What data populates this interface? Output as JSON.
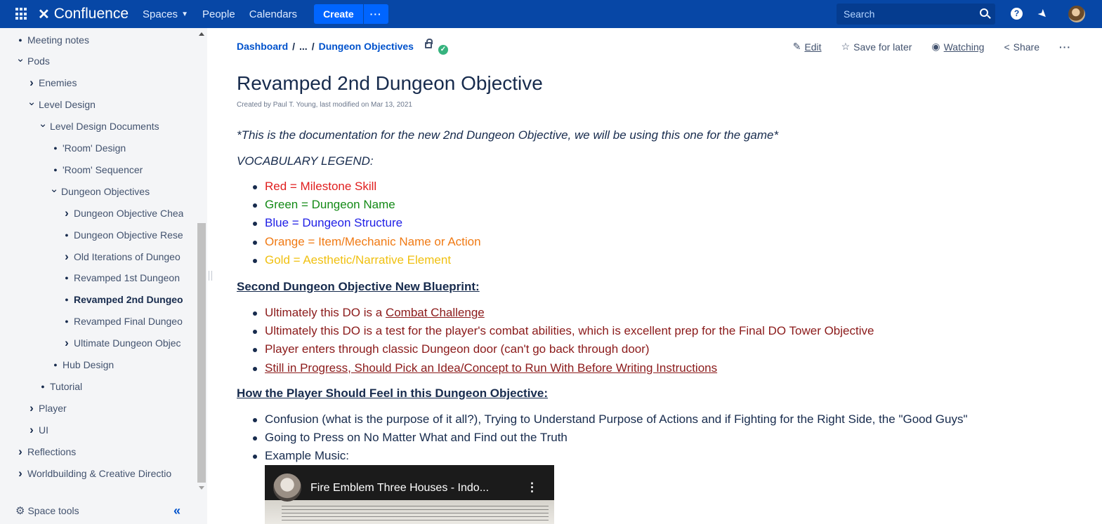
{
  "topnav": {
    "logo_text": "Confluence",
    "spaces_label": "Spaces",
    "people_label": "People",
    "calendars_label": "Calendars",
    "create_label": "Create",
    "more_label": "···",
    "search_placeholder": "Search",
    "help_label": "?",
    "brand_color": "#0747a6",
    "accent_color": "#0065ff"
  },
  "sidebar": {
    "items": [
      {
        "label": "Meeting notes",
        "marker": "bullet"
      },
      {
        "label": "Pods",
        "marker": "expanded"
      },
      {
        "label": "Enemies",
        "marker": "collapsed"
      },
      {
        "label": "Level Design",
        "marker": "expanded"
      },
      {
        "label": "Level Design Documents",
        "marker": "expanded"
      },
      {
        "label": "'Room' Design",
        "marker": "bullet"
      },
      {
        "label": "'Room' Sequencer",
        "marker": "bullet"
      },
      {
        "label": "Dungeon Objectives",
        "marker": "expanded"
      },
      {
        "label": "Dungeon Objective Chea",
        "marker": "collapsed"
      },
      {
        "label": "Dungeon Objective Rese",
        "marker": "bullet"
      },
      {
        "label": "Old Iterations of Dungeo",
        "marker": "collapsed"
      },
      {
        "label": "Revamped 1st Dungeon",
        "marker": "bullet"
      },
      {
        "label": "Revamped 2nd Dungeo",
        "marker": "bullet",
        "active": true
      },
      {
        "label": "Revamped Final Dungeo",
        "marker": "bullet"
      },
      {
        "label": "Ultimate Dungeon Objec",
        "marker": "collapsed"
      },
      {
        "label": "Hub Design",
        "marker": "bullet"
      },
      {
        "label": "Tutorial",
        "marker": "bullet"
      },
      {
        "label": "Player",
        "marker": "collapsed"
      },
      {
        "label": "UI",
        "marker": "collapsed"
      },
      {
        "label": "Reflections",
        "marker": "collapsed"
      },
      {
        "label": "Worldbuilding & Creative Directio",
        "marker": "collapsed"
      }
    ],
    "space_tools_label": "Space tools"
  },
  "breadcrumbs": {
    "root": "Dashboard",
    "ellipsis": "...",
    "parent": "Dungeon Objectives"
  },
  "page_actions": {
    "edit": "Edit",
    "save_for_later": "Save for later",
    "watching": "Watching",
    "share": "Share",
    "more": "···"
  },
  "page": {
    "title": "Revamped 2nd Dungeon Objective",
    "byline": "Created by Paul T. Young, last modified on Mar 13, 2021",
    "intro": "*This is the documentation for the new 2nd Dungeon Objective, we will be using this one for the game*",
    "vocab_heading": "VOCABULARY LEGEND:",
    "legend": [
      {
        "text": "Red = Milestone Skill",
        "color": "#e01e1e"
      },
      {
        "text": "Green = Dungeon Name",
        "color": "#138a16"
      },
      {
        "text": "Blue = Dungeon Structure",
        "color": "#2020e6"
      },
      {
        "text": "Orange = Item/Mechanic Name or Action",
        "color": "#f07a14"
      },
      {
        "text": "Gold = Aesthetic/Narrative Element",
        "color": "#f0c010"
      }
    ],
    "blueprint_heading": "Second Dungeon Objective New Blueprint:",
    "blueprint": {
      "item1_prefix": "Ultimately this DO is a ",
      "item1_link": "Combat Challenge",
      "item2": "Ultimately this DO is a test for the player's combat abilities, which is excellent prep for the Final DO Tower Objective",
      "item3": "Player enters through classic Dungeon door (can't go back through door)",
      "item4": "Still in Progress, Should Pick an Idea/Concept to Run With Before Writing Instructions"
    },
    "feel_heading": "How the Player Should Feel in this Dungeon Objective:",
    "feel": [
      "Confusion (what is the purpose of it all?), Trying to Understand Purpose of Actions and if Fighting for the Right Side, the \"Good Guys\"",
      "Going to Press on No Matter What and Find out the Truth",
      "Example Music:"
    ],
    "video_title": "Fire Emblem Three Houses - Indo..."
  }
}
